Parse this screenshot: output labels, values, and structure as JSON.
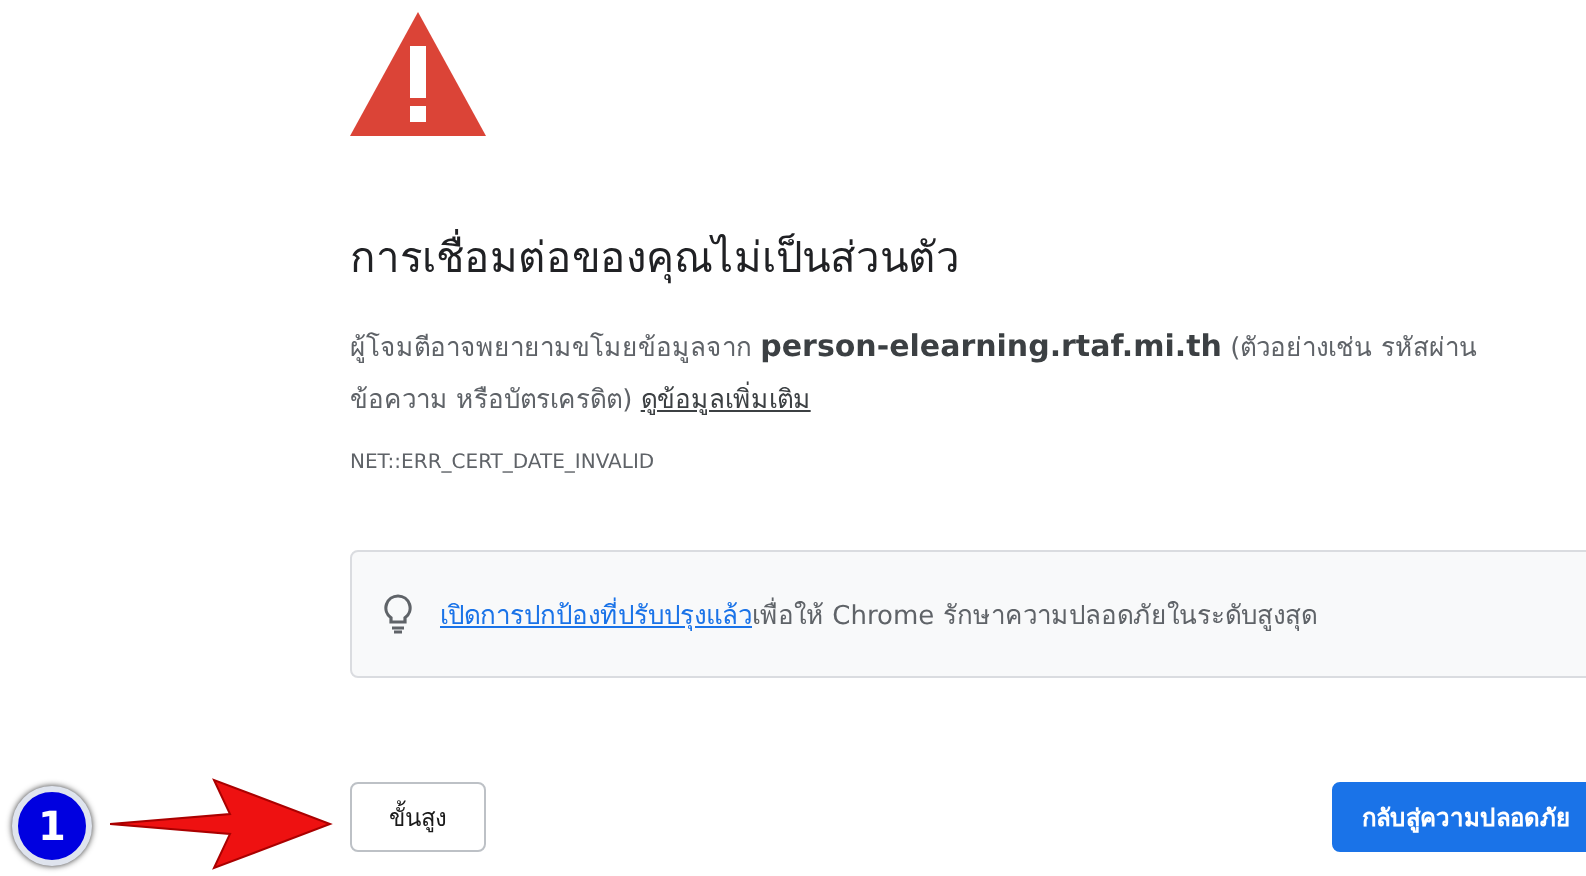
{
  "heading": "การเชื่อมต่อของคุณไม่เป็นส่วนตัว",
  "message": {
    "before": "ผู้โจมตีอาจพยายามขโมยข้อมูลจาก ",
    "host": "person-elearning.rtaf.mi.th",
    "after": " (ตัวอย่างเช่น รหัสผ่าน ข้อความ หรือบัตรเครดิต) ",
    "link": "ดูข้อมูลเพิ่มเติม"
  },
  "error_code": "NET::ERR_CERT_DATE_INVALID",
  "tip": {
    "link": "เปิดการปกป้องที่ปรับปรุงแล้ว",
    "text": "เพื่อให้ Chrome รักษาความปลอดภัยในระดับสูงสุด"
  },
  "buttons": [
    {
      "label": "ขั้นสูง",
      "kind": "secondary"
    },
    {
      "label": "กลับสู่ความปลอดภัย",
      "kind": "primary"
    }
  ],
  "annotation": {
    "badge": "1"
  }
}
